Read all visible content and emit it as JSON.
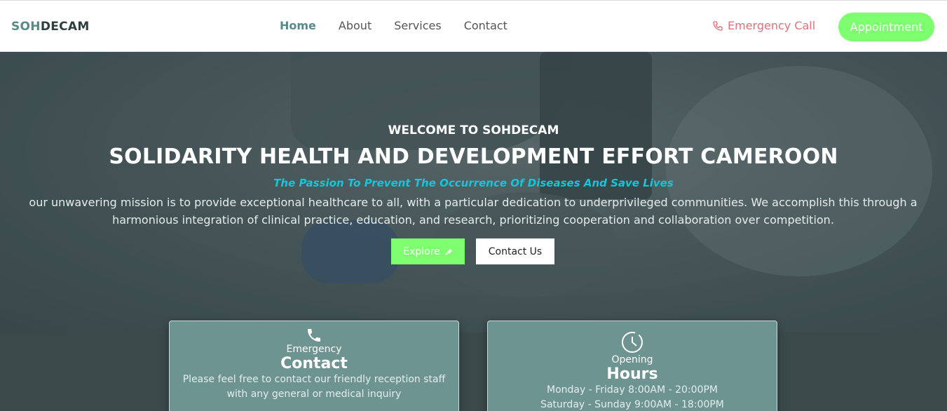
{
  "brand": {
    "part1": "SOH",
    "part2": "DECAM"
  },
  "nav": {
    "links": [
      "Home",
      "About",
      "Services",
      "Contact"
    ],
    "emergency_label": "Emergency Call",
    "appointment_label": "Appointment"
  },
  "hero": {
    "welcome": "WELCOME TO SOHDECAM",
    "headline": "SOLIDARITY HEALTH AND DEVELOPMENT EFFORT CAMEROON",
    "tagline": "The Passion To Prevent The Occurrence Of Diseases And Save Lives",
    "mission_line1": "our unwavering mission is to provide exceptional healthcare to all, with a particular dedication to underprivileged communities. We accomplish this through a",
    "mission_line2": "harmonious integration of clinical practice, education, and research, prioritizing cooperation and collaboration over competition.",
    "explore_label": "Explore",
    "contact_label": "Contact Us"
  },
  "cards": {
    "contact": {
      "small": "Emergency",
      "big": "Contact",
      "desc_line1": "Please feel free to contact our friendly reception staff",
      "desc_line2": "with any general or medical inquiry"
    },
    "hours": {
      "small": "Opening",
      "big": "Hours",
      "line1": "Monday - Friday 8:00AM - 20:00PM",
      "line2": "Saturday - Sunday 9:00AM - 18:00PM"
    }
  },
  "colors": {
    "accent_green": "#7dff6f",
    "brand_teal": "#5a8a88",
    "emergency_red": "#e0707a",
    "tagline_cyan": "#19c4d8"
  }
}
